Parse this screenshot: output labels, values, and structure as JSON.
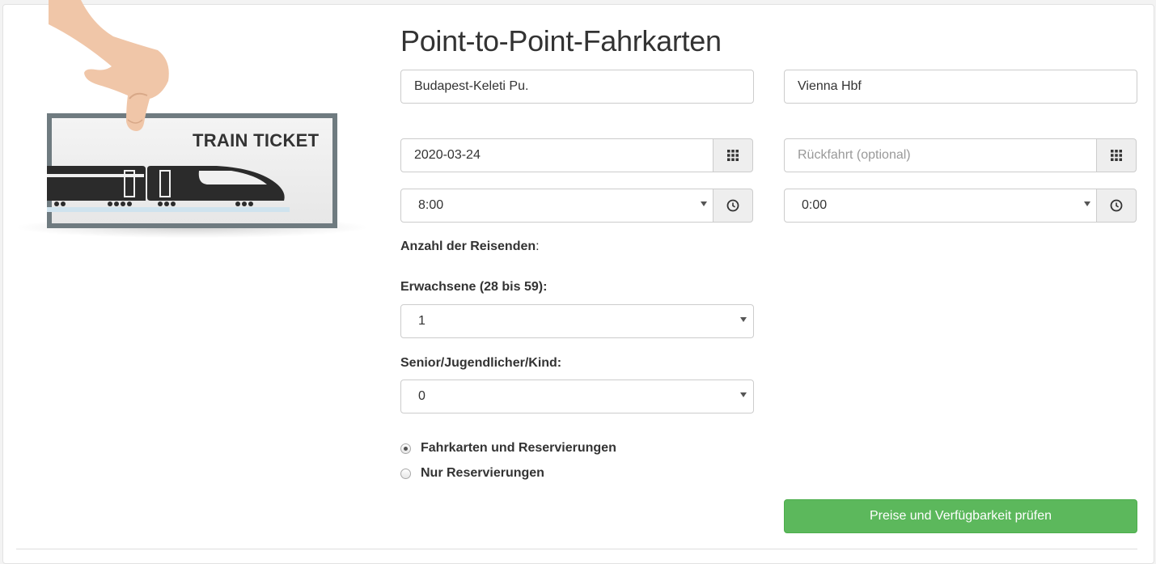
{
  "illustration": {
    "ticket_text": "TRAIN TICKET"
  },
  "form": {
    "title": "Point-to-Point-Fahrkarten",
    "from_value": "Budapest-Keleti Pu.",
    "to_value": "Vienna Hbf",
    "depart_date": "2020-03-24",
    "return_date_placeholder": "Rückfahrt (optional)",
    "depart_time": "8:00",
    "return_time": "0:00",
    "travellers_label": "Anzahl der Reisenden",
    "travellers_colon": ":",
    "adults_label": "Erwachsene (28 bis 59):",
    "adults_value": "1",
    "other_label": "Senior/Jugendlicher/Kind:",
    "other_value": "0",
    "options": [
      {
        "label": "Fahrkarten und Reservierungen",
        "selected": true
      },
      {
        "label": "Nur Reservierungen",
        "selected": false
      }
    ],
    "submit_label": "Preise und Verfügbarkeit prüfen"
  },
  "icons": {
    "calendar": "calendar-grid-icon",
    "clock": "clock-icon",
    "dropdown": "chevron-down-icon"
  },
  "colors": {
    "primary_button": "#5cb85c",
    "ticket_frame": "#6f7b80"
  }
}
